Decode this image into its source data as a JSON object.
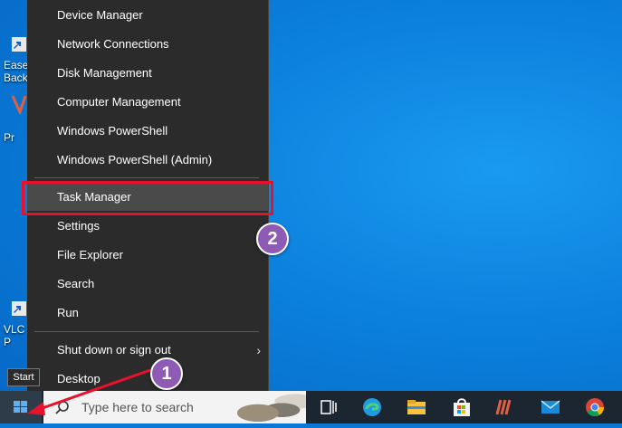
{
  "desktop_icons": [
    {
      "label": "Ease",
      "label2": "Back"
    },
    {
      "label": "Pr"
    },
    {
      "label": "VLC",
      "label2": "P"
    }
  ],
  "menu": {
    "items": [
      {
        "label": "Device Manager"
      },
      {
        "label": "Network Connections"
      },
      {
        "label": "Disk Management"
      },
      {
        "label": "Computer Management"
      },
      {
        "label": "Windows PowerShell"
      },
      {
        "label": "Windows PowerShell (Admin)"
      },
      {
        "label": "Task Manager",
        "selected": true
      },
      {
        "label": "Settings"
      },
      {
        "label": "File Explorer"
      },
      {
        "label": "Search"
      },
      {
        "label": "Run"
      },
      {
        "label": "Shut down or sign out",
        "has_submenu": true,
        "chevron": "›"
      },
      {
        "label": "Desktop"
      }
    ]
  },
  "annotations": {
    "badge1": "1",
    "badge2": "2",
    "highlight_color": "#e8102a",
    "badge_color": "#8d5bb4"
  },
  "taskbar": {
    "start_tooltip": "Start",
    "search_placeholder": "Type here to search",
    "apps": [
      "task-view-icon",
      "edge-icon",
      "file-explorer-icon",
      "store-icon",
      "app-icon",
      "mail-icon",
      "chrome-icon"
    ]
  }
}
